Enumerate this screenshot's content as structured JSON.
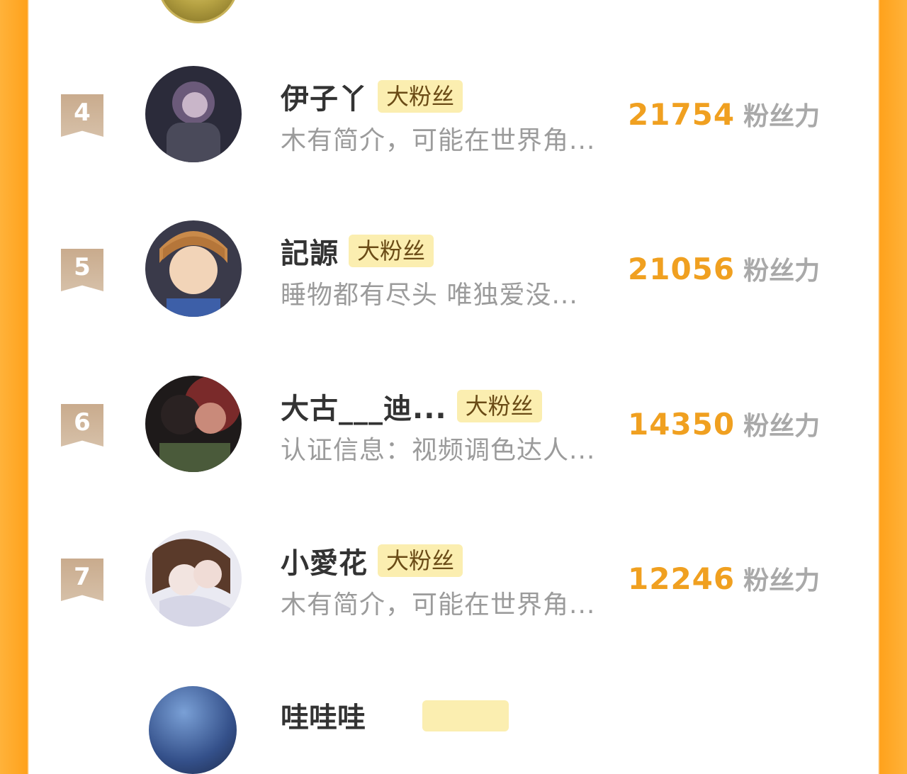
{
  "rows": [
    {
      "rank": "4",
      "name": "伊子丫",
      "badge": "大粉丝",
      "bio": "木有简介，可能在世界角...",
      "score": "21754",
      "unit": "粉丝力",
      "avatar_colors": [
        "#2b2b3a",
        "#6b5a7a",
        "#c9b6c9"
      ]
    },
    {
      "rank": "5",
      "name": "記謜",
      "badge": "大粉丝",
      "bio": "睡物都有尽头 唯独爱没...",
      "score": "21056",
      "unit": "粉丝力",
      "avatar_colors": [
        "#3a3a4a",
        "#c98a4a",
        "#f2d4b8"
      ]
    },
    {
      "rank": "6",
      "name": "大古___迪...",
      "badge": "大粉丝",
      "bio": "认证信息：视频调色达人...",
      "score": "14350",
      "unit": "粉丝力",
      "avatar_colors": [
        "#1e1a1a",
        "#7a2a2a",
        "#c98a7a"
      ]
    },
    {
      "rank": "7",
      "name": "小愛花",
      "badge": "大粉丝",
      "bio": "木有简介，可能在世界角...",
      "score": "12246",
      "unit": "粉丝力",
      "avatar_colors": [
        "#eaeaf2",
        "#5a3a2a",
        "#f2e4e0"
      ]
    }
  ],
  "partial_next": {
    "name": "哇哇哇"
  },
  "colors": {
    "accent_orange": "#f0a020",
    "frame_orange": "#ffa21c",
    "badge_bg": "#fbeeb0",
    "rank_tag": "#c9ab8d"
  }
}
